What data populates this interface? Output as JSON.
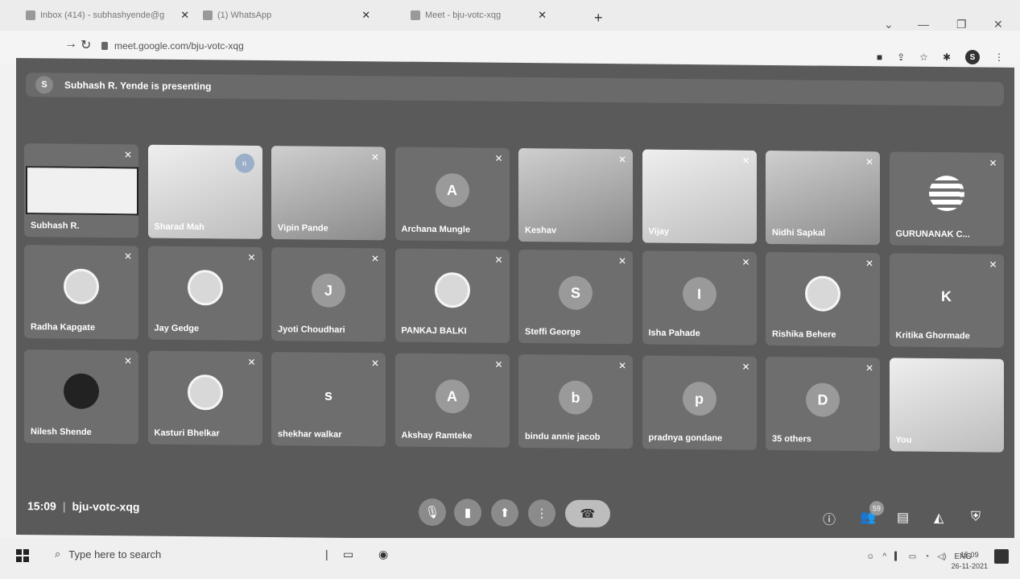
{
  "browser": {
    "tabs": [
      {
        "title": "Inbox (414) - subhashyende@g"
      },
      {
        "title": "(1) WhatsApp"
      },
      {
        "title": "Meet - bju-votc-xqg"
      }
    ],
    "new_tab": "+",
    "url": "meet.google.com/bju-votc-xqg",
    "profile_initial": "S"
  },
  "meet": {
    "presenter_initial": "S",
    "presenting_text": "Subhash R. Yende is presenting",
    "participants": [
      {
        "name": "Subhash R.",
        "kind": "slide"
      },
      {
        "name": "Sharad Mah",
        "kind": "video"
      },
      {
        "name": "Vipin Pande",
        "kind": "video"
      },
      {
        "name": "Archana Mungle",
        "kind": "initial",
        "initial": "A"
      },
      {
        "name": "Keshav",
        "kind": "video"
      },
      {
        "name": "Vijay",
        "kind": "video"
      },
      {
        "name": "Nidhi Sapkal",
        "kind": "video"
      },
      {
        "name": "GURUNANAK C...",
        "kind": "logo"
      },
      {
        "name": "Radha Kapgate",
        "kind": "photo"
      },
      {
        "name": "Jay Gedge",
        "kind": "photo"
      },
      {
        "name": "Jyoti Choudhari",
        "kind": "initial",
        "initial": "J"
      },
      {
        "name": "PANKAJ BALKI",
        "kind": "photo"
      },
      {
        "name": "Steffi George",
        "kind": "initial",
        "initial": "S"
      },
      {
        "name": "Isha Pahade",
        "kind": "initial",
        "initial": "I"
      },
      {
        "name": "Rishika Behere",
        "kind": "photo"
      },
      {
        "name": "Kritika Ghormade",
        "kind": "initial-flat",
        "initial": "K"
      },
      {
        "name": "Nilesh Shende",
        "kind": "photo-dark"
      },
      {
        "name": "Kasturi Bhelkar",
        "kind": "photo"
      },
      {
        "name": "shekhar walkar",
        "kind": "initial-flat",
        "initial": "s"
      },
      {
        "name": "Akshay Ramteke",
        "kind": "initial",
        "initial": "A"
      },
      {
        "name": "bindu annie jacob",
        "kind": "initial",
        "initial": "b"
      },
      {
        "name": "pradnya gondane",
        "kind": "initial",
        "initial": "p"
      },
      {
        "name": "35 others",
        "kind": "others",
        "initial": "D"
      },
      {
        "name": "You",
        "kind": "video"
      }
    ],
    "time": "15:09",
    "meeting_code": "bju-votc-xqg",
    "people_count": "59"
  },
  "taskbar": {
    "search_placeholder": "Type here to search",
    "language": "ENG",
    "time": "15:09",
    "date": "26-11-2021"
  }
}
